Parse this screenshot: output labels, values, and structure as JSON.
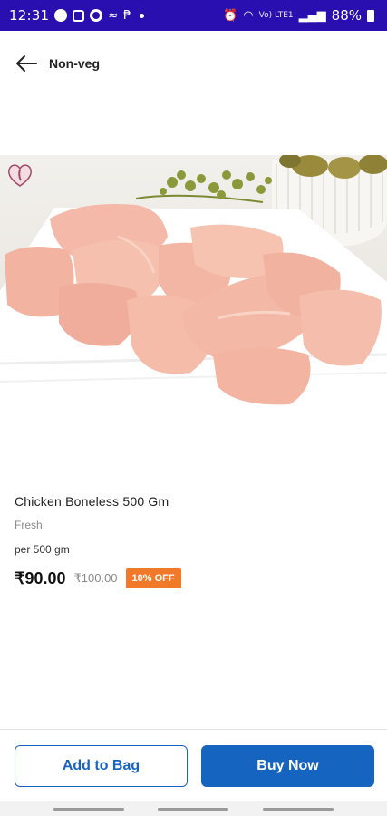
{
  "status_bar": {
    "time": "12:31",
    "battery": "88%",
    "carrier_small": "Vo) LTE1"
  },
  "header": {
    "title": "Non-veg",
    "back_icon": "arrow-left-icon"
  },
  "product": {
    "name": "Chicken Boneless 500 Gm",
    "tag": "Fresh",
    "unit": "per 500 gm",
    "price": "₹90.00",
    "mrp": "₹100.00",
    "discount": "10% OFF",
    "wishlist_icon": "heart-icon"
  },
  "actions": {
    "add_to_bag": "Add to Bag",
    "buy_now": "Buy Now"
  },
  "colors": {
    "status_bar": "#2a0fb0",
    "primary": "#1565c0",
    "discount": "#f07a2a"
  }
}
